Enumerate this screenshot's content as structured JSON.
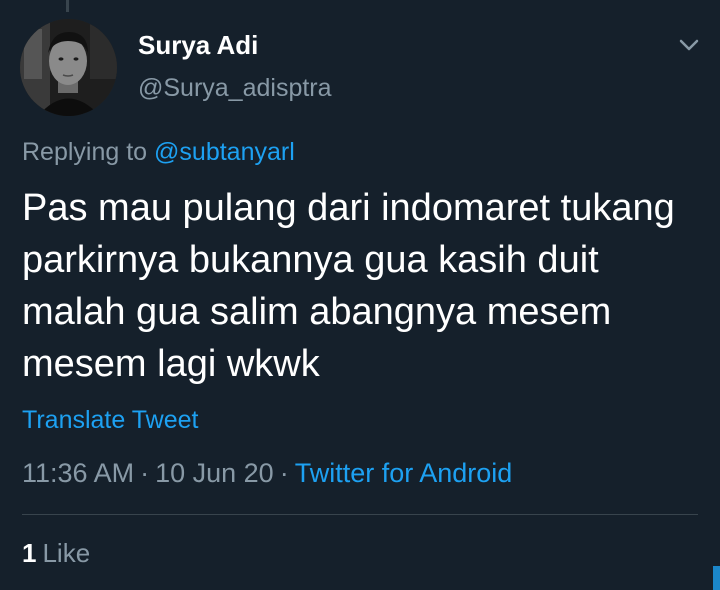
{
  "tweet": {
    "author": {
      "display_name": "Surya Adi",
      "handle": "@Surya_adisptra",
      "avatar_icon": "profile-photo"
    },
    "reply": {
      "prefix": "Replying to",
      "mention": "@subtanyarl"
    },
    "text": "Pas mau pulang dari indomaret tukang parkirnya bukannya gua kasih duit malah gua salim abangnya mesem mesem lagi wkwk",
    "translate_label": "Translate Tweet",
    "meta": {
      "time": "11:36 AM",
      "date": "10 Jun 20",
      "separator": "·",
      "source": "Twitter for Android"
    },
    "likes": {
      "count": "1",
      "label": "Like"
    },
    "more_icon": "chevron-down-icon"
  },
  "colors": {
    "background": "#15202b",
    "text_primary": "#ffffff",
    "text_secondary": "#8899a6",
    "accent": "#1da1f2",
    "divider": "#38444d"
  }
}
